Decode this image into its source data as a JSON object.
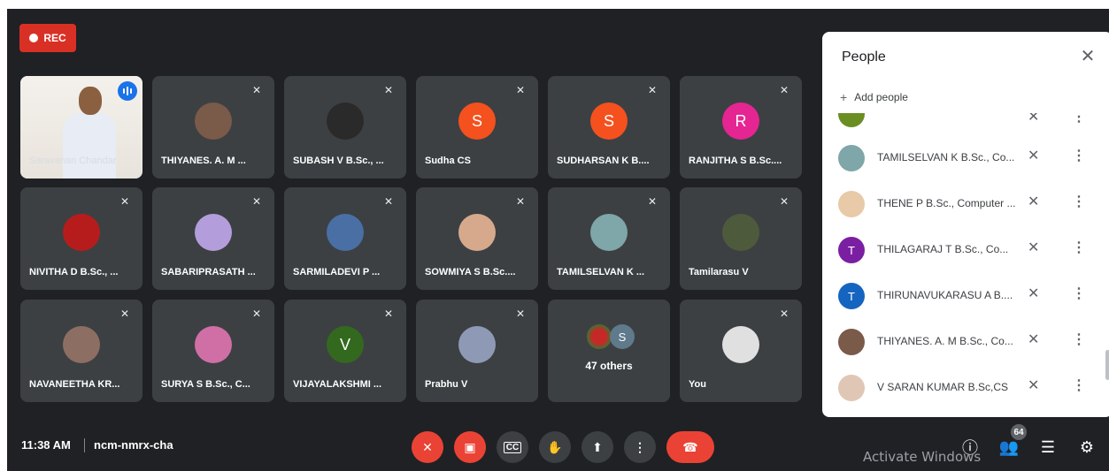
{
  "recording": {
    "label": "REC",
    "color": "#d93025"
  },
  "presenter": {
    "name": "Saravanan Chandar",
    "speaking_icon": "audio-wave-icon"
  },
  "tiles": [
    {
      "name": "THIYANES. A. M ...",
      "avatar": "photo",
      "avatar_color": "#7a5a48"
    },
    {
      "name": "SUBASH V B.Sc., ...",
      "avatar": "photo",
      "avatar_color": "#2a2a2a"
    },
    {
      "name": "Sudha CS",
      "avatar": "S",
      "avatar_color": "#f4511e"
    },
    {
      "name": "SUDHARSAN K B....",
      "avatar": "S",
      "avatar_color": "#f4511e"
    },
    {
      "name": "RANJITHA S B.Sc....",
      "avatar": "R",
      "avatar_color": "#e52592"
    },
    {
      "name": "NIVITHA D B.Sc., ...",
      "avatar": "photo",
      "avatar_color": "#b71c1c"
    },
    {
      "name": "SABARIPRASATH ...",
      "avatar": "photo",
      "avatar_color": "#b39ddb"
    },
    {
      "name": "SARMILADEVI P ...",
      "avatar": "photo",
      "avatar_color": "#4a6fa5"
    },
    {
      "name": "SOWMIYA S B.Sc....",
      "avatar": "photo",
      "avatar_color": "#d7a98c"
    },
    {
      "name": "TAMILSELVAN K ...",
      "avatar": "photo",
      "avatar_color": "#7fa6a8"
    },
    {
      "name": "Tamilarasu V",
      "avatar": "photo",
      "avatar_color": "#4e5a3c"
    },
    {
      "name": "NAVANEETHA KR...",
      "avatar": "photo",
      "avatar_color": "#8d6e63"
    },
    {
      "name": "SURYA S B.Sc., C...",
      "avatar": "photo",
      "avatar_color": "#d06fa5"
    },
    {
      "name": "VIJAYALAKSHMI ...",
      "avatar": "V",
      "avatar_color": "#33691e"
    },
    {
      "name": "Prabhu V",
      "avatar": "photo",
      "avatar_color": "#8e9ab5"
    },
    {
      "name": "You",
      "avatar": "photo",
      "avatar_color": "#e0e0e0"
    }
  ],
  "others": {
    "label": "47 others",
    "avatar_letter": "S"
  },
  "people_panel": {
    "title": "People",
    "add_label": "Add people",
    "rows": [
      {
        "name": "TAMILSELVAN K B.Sc., Co...",
        "avatar": "photo",
        "avatar_color": "#7fa6a8"
      },
      {
        "name": "THENE P B.Sc., Computer ...",
        "avatar": "photo",
        "avatar_color": "#e8c9a8"
      },
      {
        "name": "THILAGARAJ T B.Sc., Co...",
        "avatar": "T",
        "avatar_color": "#7b1fa2"
      },
      {
        "name": "THIRUNAVUKARASU A B....",
        "avatar": "T",
        "avatar_color": "#1565c0"
      },
      {
        "name": "THIYANES. A. M B.Sc., Co...",
        "avatar": "photo",
        "avatar_color": "#7a5a48"
      },
      {
        "name": "V SARAN KUMAR B.Sc,CS",
        "avatar": "photo",
        "avatar_color": "#e0c7b5"
      }
    ]
  },
  "bottom_bar": {
    "time": "11:38 AM",
    "meeting_code": "ncm-nmrx-cha",
    "participant_count": "64"
  },
  "watermark": "Activate Windows"
}
